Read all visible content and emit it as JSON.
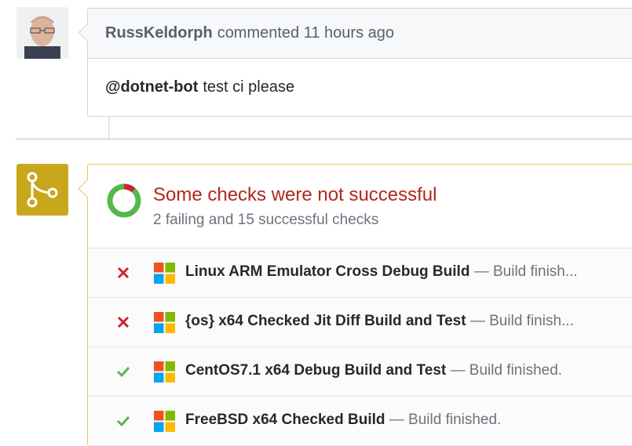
{
  "comment": {
    "author": "RussKeldorph",
    "meta": "commented 11 hours ago",
    "mention": "@dotnet-bot",
    "body": "test ci please"
  },
  "status": {
    "title": "Some checks were not successful",
    "subtitle": "2 failing and 15 successful checks",
    "failing": 2,
    "successful": 15,
    "colors": {
      "fail": "#cb2431",
      "success": "#55b84a",
      "title": "#b3261e",
      "merge_icon_bg": "#c9a71d"
    }
  },
  "checks": [
    {
      "state": "failure",
      "name": "Linux ARM Emulator Cross Debug Build",
      "desc": " — Build finish..."
    },
    {
      "state": "failure",
      "name": "{os} x64 Checked Jit Diff Build and Test",
      "desc": " — Build finish..."
    },
    {
      "state": "success",
      "name": "CentOS7.1 x64 Debug Build and Test",
      "desc": " — Build finished."
    },
    {
      "state": "success",
      "name": "FreeBSD x64 Checked Build",
      "desc": " — Build finished."
    }
  ],
  "icons": {
    "avatar": "user-avatar",
    "merge": "git-branch-icon",
    "fail": "x-icon",
    "success": "checkmark-icon",
    "logo": "microsoft-logo"
  }
}
